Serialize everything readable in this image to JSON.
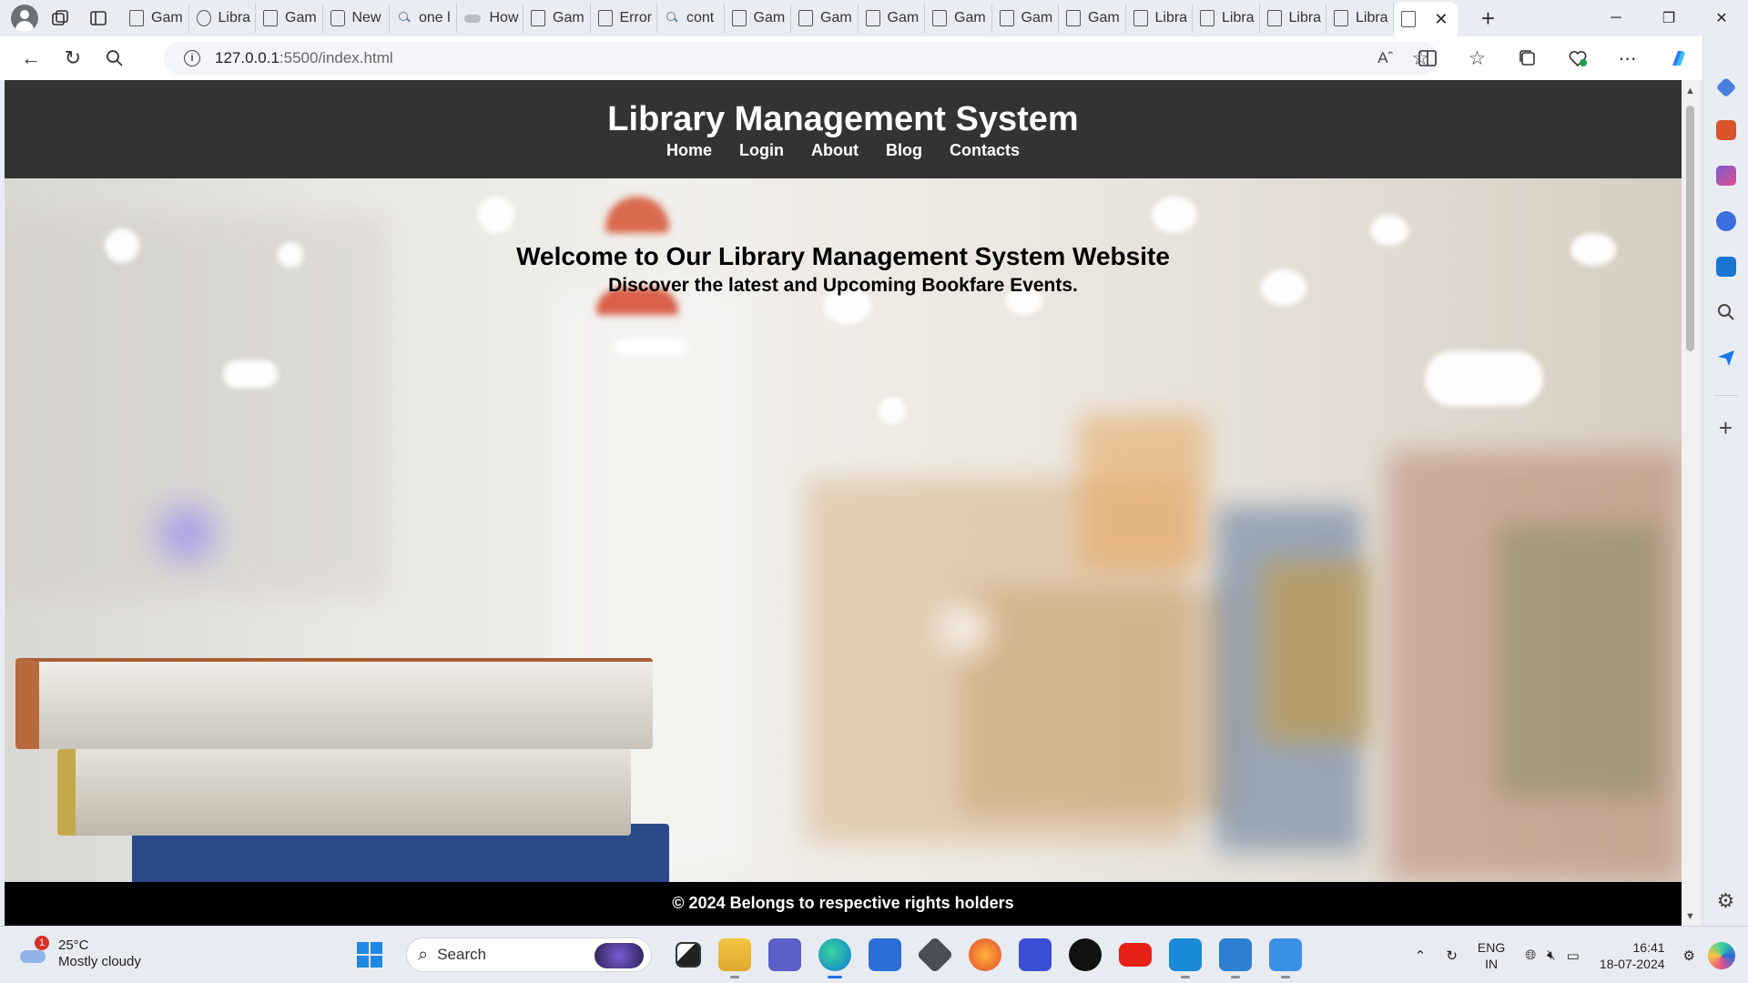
{
  "browser": {
    "tabs": [
      {
        "label": "Gam",
        "icon": "page-icon"
      },
      {
        "label": "Libra",
        "icon": "globe-icon"
      },
      {
        "label": "Gam",
        "icon": "page-icon"
      },
      {
        "label": "New",
        "icon": "window-icon"
      },
      {
        "label": "one l",
        "icon": "search-icon"
      },
      {
        "label": "How",
        "icon": "cloud-icon"
      },
      {
        "label": "Gam",
        "icon": "page-icon"
      },
      {
        "label": "Error",
        "icon": "page-icon"
      },
      {
        "label": "cont",
        "icon": "search-icon"
      },
      {
        "label": "Gam",
        "icon": "page-icon"
      },
      {
        "label": "Gam",
        "icon": "page-icon"
      },
      {
        "label": "Gam",
        "icon": "page-icon"
      },
      {
        "label": "Gam",
        "icon": "page-icon"
      },
      {
        "label": "Gam",
        "icon": "page-icon"
      },
      {
        "label": "Gam",
        "icon": "page-icon"
      },
      {
        "label": "Libra",
        "icon": "page-icon"
      },
      {
        "label": "Libra",
        "icon": "page-icon"
      },
      {
        "label": "Libra",
        "icon": "page-icon"
      },
      {
        "label": "Libra",
        "icon": "page-icon"
      }
    ],
    "active_tab_close": "✕",
    "new_tab": "+",
    "url_host": "127.0.0.1",
    "url_rest": ":5500/index.html"
  },
  "site": {
    "title": "Library Management System",
    "nav": [
      "Home",
      "Login",
      "About",
      "Blog",
      "Contacts"
    ],
    "hero_heading": "Welcome to Our Library Management System Website",
    "hero_subheading": "Discover the latest and Upcoming Bookfare Events.",
    "footer": "© 2024 Belongs to respective rights holders",
    "colors": {
      "header": "#333333",
      "footer": "#000000",
      "text": "#ffffff"
    }
  },
  "taskbar": {
    "weather_badge": "1",
    "weather_temp": "25°C",
    "weather_desc": "Mostly cloudy",
    "search_placeholder": "Search",
    "lang_1": "ENG",
    "lang_2": "IN",
    "time": "16:41",
    "date": "18-07-2024"
  }
}
